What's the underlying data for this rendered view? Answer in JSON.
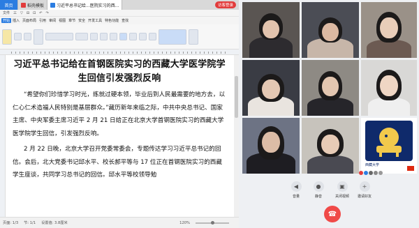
{
  "wps": {
    "tabs": [
      {
        "label": "首页"
      },
      {
        "label": "稻壳模板"
      },
      {
        "label": "习近平总书记给...医院实习的西..."
      }
    ],
    "top_button": "访客登录",
    "toolbar_items": [
      "文件",
      "三",
      "▽",
      "⊟",
      "⊡",
      "↶",
      "↷"
    ],
    "menu": [
      {
        "label": "开始",
        "selected": true
      },
      {
        "label": "插入",
        "selected": false
      },
      {
        "label": "页面布局",
        "selected": false
      },
      {
        "label": "引用",
        "selected": false
      },
      {
        "label": "审阅",
        "selected": false
      },
      {
        "label": "视图",
        "selected": false
      },
      {
        "label": "章节",
        "selected": false
      },
      {
        "label": "安全",
        "selected": false
      },
      {
        "label": "开发工具",
        "selected": false
      },
      {
        "label": "特色功能",
        "selected": false
      },
      {
        "label": "查找",
        "selected": false
      }
    ],
    "doc": {
      "title": "习近平总书记给在首钢医院实习的西藏大学医学院学生回信引发强烈反响",
      "paragraphs": [
        "“希望你们珍惜学习时光，练就过硬本领，毕业后到人民最需要的地方去，以仁心仁术造福人民特别是基层群众。”藏历新年来临之际，中共中央总书记、国家主席、中央军委主席习近平 2 月 21 日给正在北京大学首钢医院实习的西藏大学医学院学生回信，引发强烈反响。",
        "2 月 22 日晚，北京大学召开党委常委会，专题传达学习习近平总书记的回信。会后，北大党委书记邱水平、校长郝平等与 17 位正在首钢医院实习的西藏学生座谈，共同学习总书记的回信。邱水平等校领导勉"
      ]
    },
    "status": {
      "page": "页面: 1/3",
      "section": "节: 1/1",
      "setting": "设置值: 3.8厘米",
      "zoom": "120%"
    }
  },
  "call": {
    "controls": [
      {
        "label": "音量",
        "icon": "speaker-icon"
      },
      {
        "label": "静音",
        "icon": "mic-icon"
      },
      {
        "label": "关闭视频",
        "icon": "camera-icon"
      },
      {
        "label": "邀请好友",
        "icon": "add-user-icon"
      }
    ],
    "logo_label": "西藏大学"
  },
  "colors": {
    "accent": "#2b7de1",
    "hangup": "#f04a48"
  }
}
